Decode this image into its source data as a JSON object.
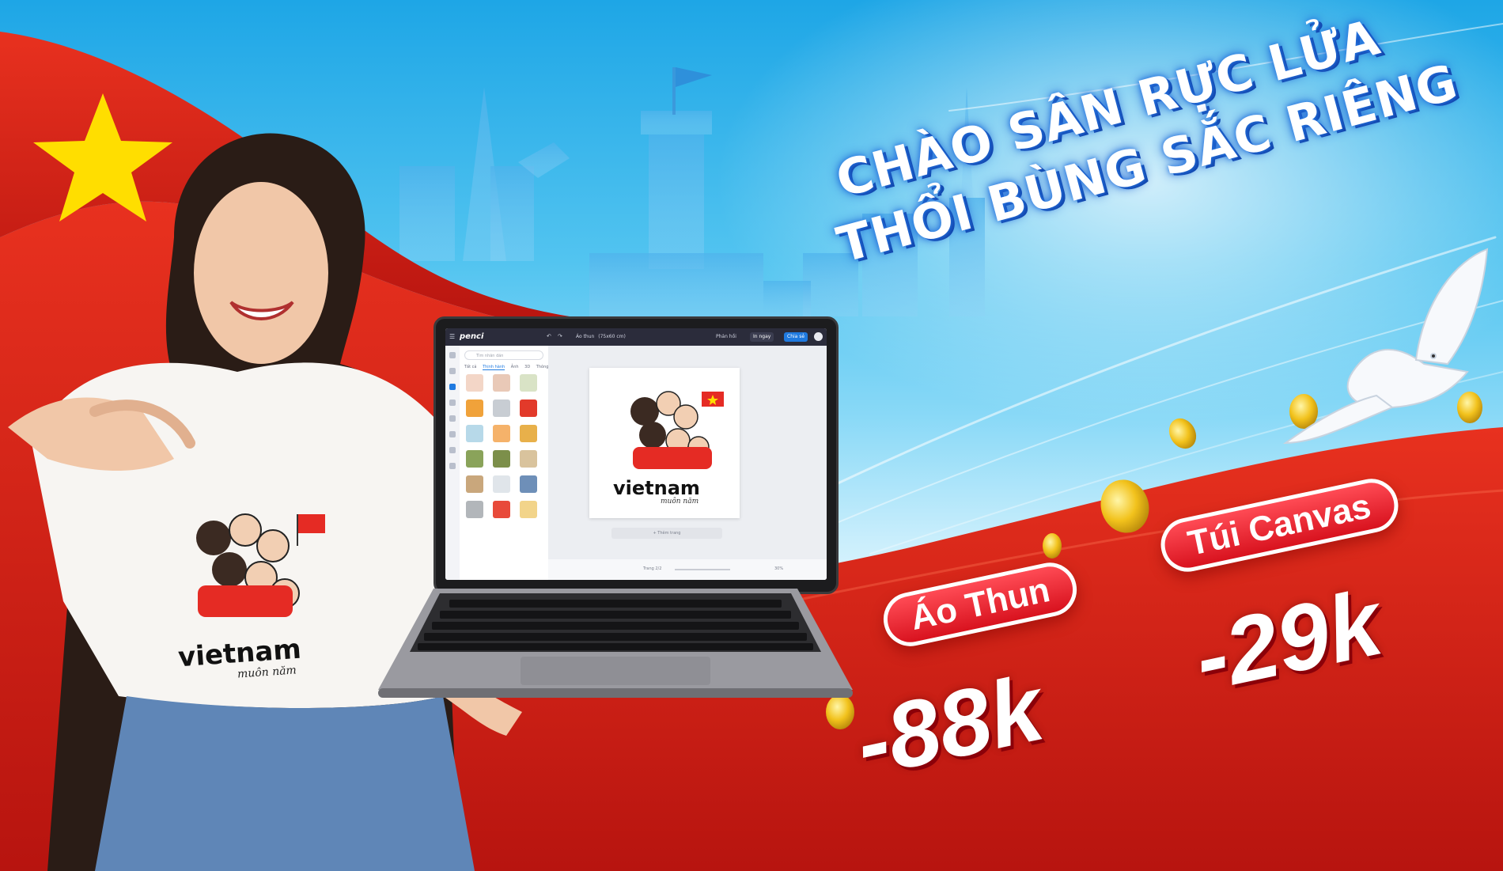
{
  "headline": {
    "line1": "CHÀO SÂN RỰC LỬA",
    "line2": "THỔI BÙNG SẮC RIÊNG"
  },
  "offers": [
    {
      "label": "Áo Thun",
      "price": "-88k"
    },
    {
      "label": "Túi Canvas",
      "price": "-29k"
    }
  ],
  "tshirt_print": {
    "word": "vietnam",
    "sub": "muôn năm"
  },
  "laptop_screen": {
    "app_logo": "penci",
    "document_title": "Áo thun",
    "document_size": "(75x60 cm)",
    "share_label": "Phản hồi",
    "print_label": "In ngay",
    "share_button": "Chia sẻ",
    "search_placeholder": "Tìm nhãn dán",
    "tabs": [
      "Tất cả",
      "Thịnh hành",
      "Ảnh",
      "3D",
      "Thông minh"
    ],
    "page_label": "Trang 2/2",
    "zoom": "30%",
    "add_page": "+ Thêm trang",
    "canvas_word": "vietnam",
    "canvas_sub": "muôn năm"
  },
  "colors": {
    "flag_red": "#da251d",
    "star_yellow": "#ffde00",
    "sky_blue": "#1ea6e6",
    "pill_red": "#e41b26",
    "laptop_bar": "#2b2c3b"
  }
}
